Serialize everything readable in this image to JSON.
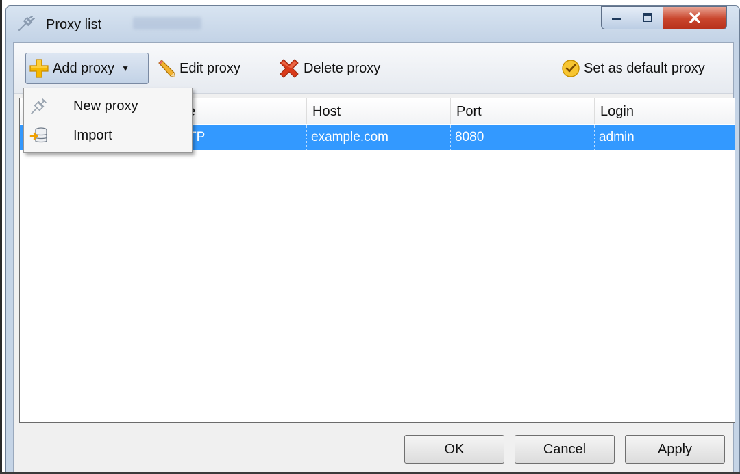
{
  "window": {
    "title": "Proxy list",
    "icons": {
      "title": "plug-icon",
      "minimize": "minimize-icon",
      "maximize": "maximize-icon",
      "close": "close-icon"
    }
  },
  "toolbar": {
    "add_label": "Add proxy",
    "edit_label": "Edit proxy",
    "delete_label": "Delete proxy",
    "default_label": "Set as default proxy",
    "icons": {
      "add": "plus-icon",
      "edit": "pencil-icon",
      "delete": "delete-x-icon",
      "default": "check-circle-icon"
    }
  },
  "dropdown": {
    "items": [
      {
        "label": "New proxy",
        "icon": "plug-icon"
      },
      {
        "label": "Import",
        "icon": "import-database-icon"
      }
    ]
  },
  "grid": {
    "columns": [
      "Type",
      "Host",
      "Port",
      "Login"
    ],
    "header_visible": {
      "type": "pe"
    },
    "rows": [
      {
        "type": "HTTP",
        "type_visible": "TP",
        "host": "example.com",
        "port": "8080",
        "login": "admin",
        "selected": true
      }
    ]
  },
  "footer": {
    "ok_label": "OK",
    "cancel_label": "Cancel",
    "apply_label": "Apply"
  },
  "colors": {
    "selection": "#3399ff",
    "accent_add": "#f5b800",
    "delete": "#d93a1a",
    "close_button": "#c9452c"
  }
}
